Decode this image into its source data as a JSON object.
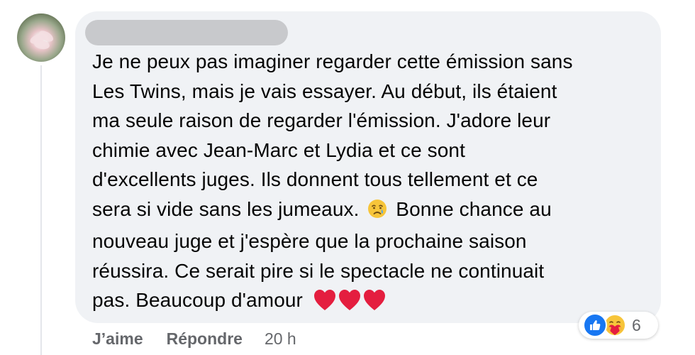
{
  "comment": {
    "author_redacted": true,
    "text_lines": [
      "Je ne peux pas imaginer regarder cette émission sans",
      "Les Twins, mais je vais essayer. Au début, ils étaient",
      "ma seule raison de regarder l'émission. J'adore leur",
      "chimie avec Jean-Marc et Lydia et ce sont",
      "d'excellents juges. Ils donnent tous tellement et ce",
      "sera si vide sans les jumeaux.",
      "Bonne chance au",
      "nouveau juge et j'espère que la prochaine saison",
      "réussira. Ce serait pire si le spectacle ne continuait",
      "pas. Beaucoup d'amour"
    ],
    "emojis": {
      "inline": "crying-face-icon",
      "closing": [
        "red-heart-icon",
        "red-heart-icon",
        "red-heart-icon"
      ]
    }
  },
  "actions": {
    "like_label": "J’aime",
    "reply_label": "Répondre",
    "timestamp": "20 h"
  },
  "reactions": {
    "icons": [
      "like-icon",
      "care-icon"
    ],
    "count": "6"
  },
  "colors": {
    "bubble_bg": "#f0f2f5",
    "text": "#050505",
    "secondary_text": "#65676b",
    "like_blue": "#1877f2",
    "heart_red": "#e41e3f"
  }
}
